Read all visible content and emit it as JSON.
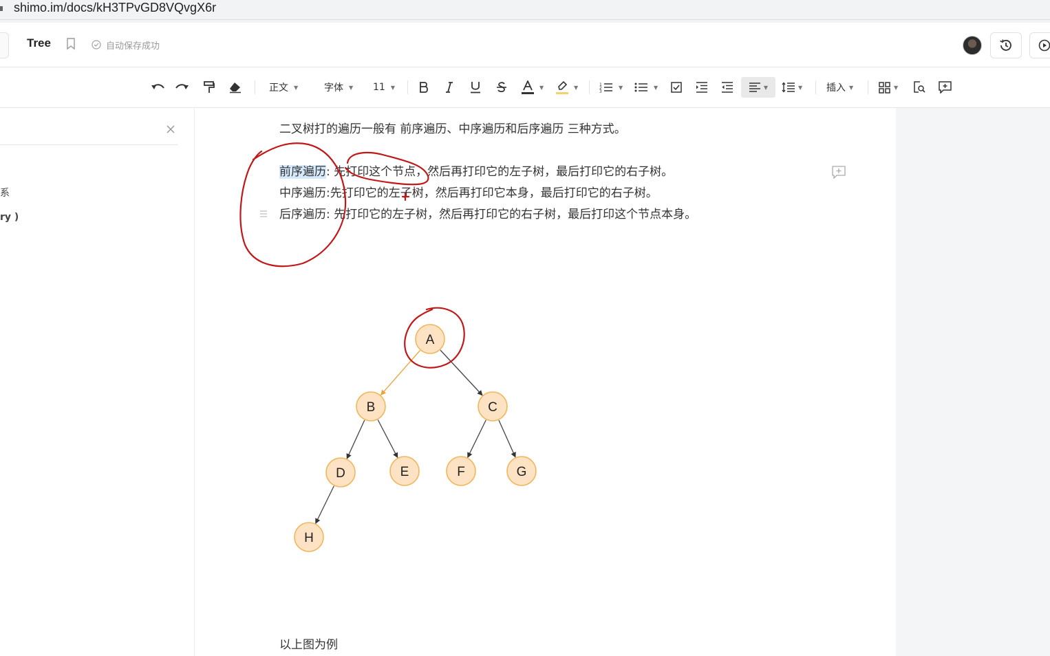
{
  "browser": {
    "url": "shimo.im/docs/kH3TPvGD8VQvgX6r"
  },
  "header": {
    "title": "Tree",
    "save_status": "自动保存成功"
  },
  "toolbar": {
    "style_label": "正文",
    "font_label": "字体",
    "size_label": "11",
    "insert_label": "插入"
  },
  "outline": {
    "items": [
      "系",
      "ry )"
    ]
  },
  "doc": {
    "intro": "二叉树打的遍历一般有 前序遍历、中序遍历和后序遍历 三种方式。",
    "preorder_term": "前序遍历",
    "preorder_rest": ": 先打印这个节点，然后再打印它的左子树，最后打印它的右子树。",
    "inorder": "中序遍历:先打印它的左子树，然后再打印它本身，最后打印它的右子树。",
    "postorder": "后序遍历: 先打印它的左子树，然后再打印它的右子树，最后打印这个节点本身。",
    "footer_text": "以上图为例"
  },
  "tree": {
    "nodes": [
      "A",
      "B",
      "C",
      "D",
      "E",
      "F",
      "G",
      "H"
    ],
    "node_fill": "#fde3c4",
    "node_stroke": "#f0b65a",
    "highlight_edge_color": "#e8a33a"
  },
  "colors": {
    "annotation": "#c01818",
    "selection": "#d6e8fb"
  }
}
